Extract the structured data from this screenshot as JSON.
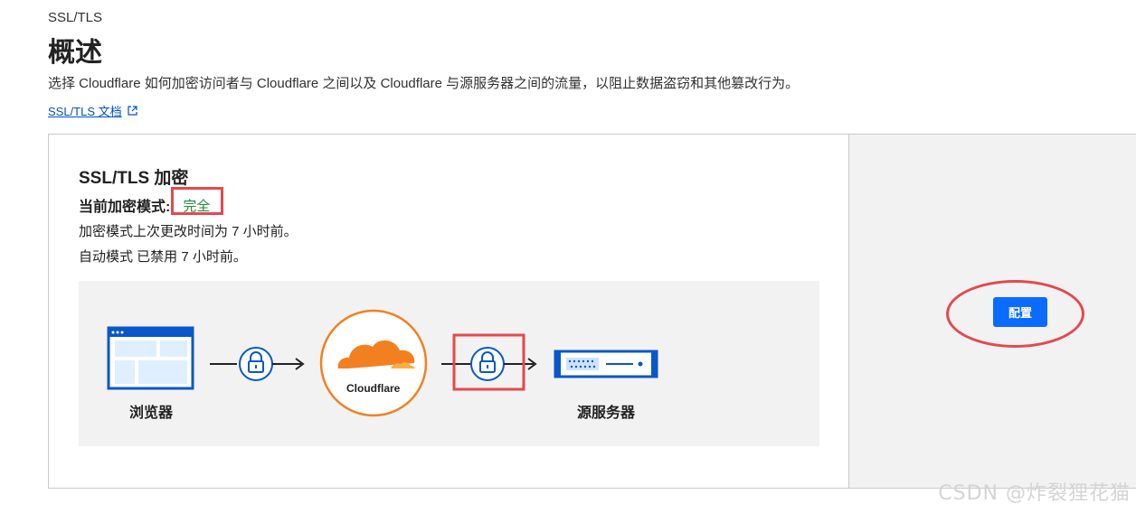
{
  "header": {
    "eyebrow": "SSL/TLS",
    "title": "概述",
    "description": "选择 Cloudflare 如何加密访问者与 Cloudflare 之间以及 Cloudflare 与源服务器之间的流量，以阻止数据盗窃和其他篡改行为。",
    "doc_link": "SSL/TLS 文档",
    "doc_link_icon": "external-link-icon"
  },
  "card": {
    "title": "SSL/TLS 加密",
    "mode_label": "当前加密模式:",
    "mode_value": "完全",
    "changed_text": "加密模式上次更改时间为 7 小时前。",
    "auto_text": "自动模式 已禁用 7 小时前。",
    "configure_button": "配置"
  },
  "diagram": {
    "browser_label": "浏览器",
    "cloudflare_label": "Cloudflare",
    "origin_label": "源服务器",
    "icons": [
      "browser-window-icon",
      "lock-icon",
      "cloudflare-cloud-icon",
      "lock-icon",
      "server-icon"
    ]
  },
  "colors": {
    "accent_blue": "#0a6bff",
    "link_blue": "#0051c3",
    "status_green": "#1e8a3c",
    "cloudflare_orange": "#f38020",
    "annotation_red": "#e5484d"
  },
  "watermark": "CSDN @炸裂狸花猫"
}
